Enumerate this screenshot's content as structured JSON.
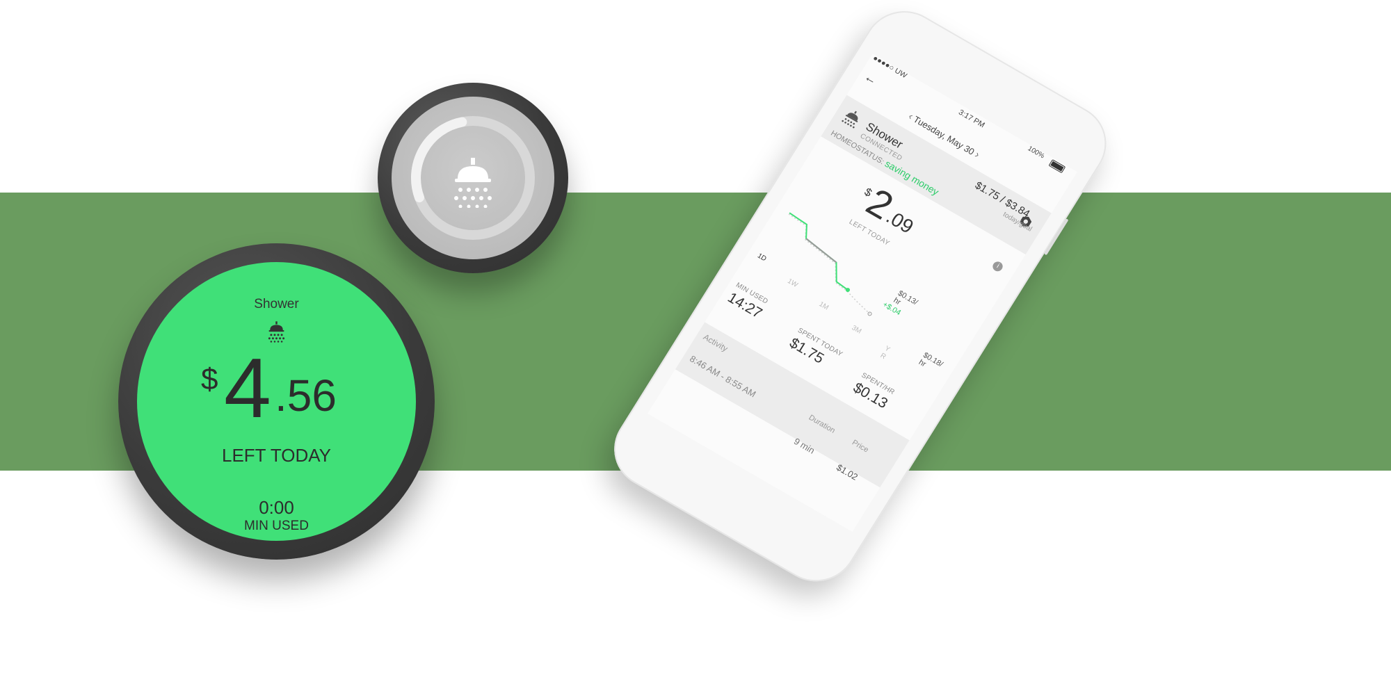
{
  "colors": {
    "band": "#6a9c5f",
    "dial_face": "#40e078",
    "knob_face": "#bcbcbc",
    "accent_green": "#2ecc6a"
  },
  "knob": {
    "icon": "shower-icon",
    "ring_progress": 0.55
  },
  "dial": {
    "title": "Shower",
    "icon": "shower-icon",
    "currency": "$",
    "amount_int": "4",
    "amount_dec": ".56",
    "amount_label": "LEFT TODAY",
    "time_value": "0:00",
    "time_label": "MIN USED"
  },
  "phone": {
    "status": {
      "carrier": "●●●●○ UW",
      "time": "3:17 PM",
      "battery": "100%",
      "battery_level": 1.0
    },
    "back_icon": "back-arrow-icon",
    "date": "Tuesday, May 30",
    "device": {
      "name": "Shower",
      "status": "CONNECTED",
      "icon": "shower-icon",
      "settings_icon": "settings-icon",
      "ratio": "$1.75 / $3.84",
      "ratio_label": "today/goal"
    },
    "homeostatus": {
      "label": "HOMEOSTATUS:",
      "value": "saving money"
    },
    "info_icon": "info-icon",
    "remaining": {
      "currency": "$",
      "int": "2",
      "dec": ".09",
      "label": "LEFT TODAY"
    },
    "chart": {
      "rate_a_line1": "$0.13/",
      "rate_a_line2": "hr",
      "rate_a_green": "+$.04",
      "rate_b_line1": "$0.18/",
      "rate_b_line2": "hr"
    },
    "ranges": [
      "1D",
      "1W",
      "1M",
      "3M",
      "Y",
      "R"
    ],
    "stats": {
      "min_used_label": "MIN USED",
      "min_used": "14:27",
      "spent_today_label": "SPENT TODAY",
      "spent_today": "$1.75",
      "spent_hr_label": "SPENT/HR",
      "spent_hr": "$0.13"
    },
    "activity": {
      "title": "Activity",
      "duration_label": "Duration",
      "price_label": "Price",
      "rows": [
        {
          "time": "8:46 AM - 8:55 AM",
          "duration": "9 min",
          "price": "$1.02"
        }
      ]
    }
  }
}
